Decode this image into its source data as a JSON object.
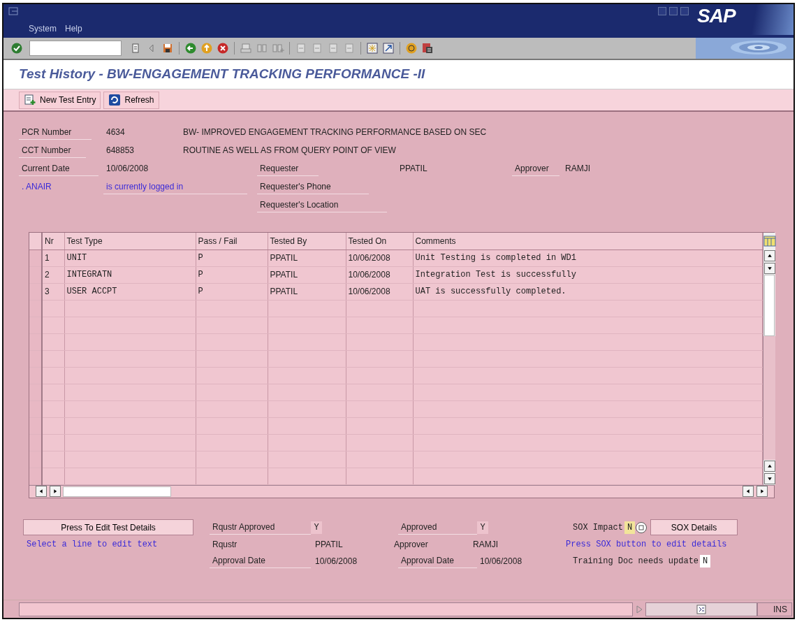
{
  "window": {
    "menu": [
      {
        "label": "System"
      },
      {
        "label": "Help"
      }
    ],
    "logo": "SAP"
  },
  "title": "Test History - BW-ENGAGEMENT TRACKING PERFORMANCE -II",
  "app_toolbar": [
    {
      "label": "New Test Entry",
      "kind": "new"
    },
    {
      "label": "Refresh",
      "kind": "refresh"
    }
  ],
  "header": {
    "pcr": {
      "label": "PCR Number",
      "value": "4634",
      "description": "BW- IMPROVED ENGAGEMENT TRACKING PERFORMANCE BASED ON SEC"
    },
    "cct": {
      "label": "CCT Number",
      "value": "648853",
      "description": "ROUTINE AS WELL AS FROM QUERY POINT OF VIEW"
    },
    "current_date": {
      "label": "Current Date",
      "value": "10/06/2008"
    },
    "user": {
      "name": ". ANAIR",
      "status": "is currently logged in"
    },
    "requester": {
      "label": "Requester",
      "value": "PPATIL"
    },
    "approver": {
      "label": "Approver",
      "value": "RAMJI"
    },
    "requester_phone": {
      "label": "Requester's Phone"
    },
    "requester_location": {
      "label": "Requester's Location"
    }
  },
  "table": {
    "columns": [
      "Nr",
      "Test Type",
      "Pass / Fail",
      "Tested By",
      "Tested On",
      "Comments"
    ],
    "rows": [
      {
        "nr": "1",
        "test_type": "UNIT",
        "pass_fail": "P",
        "tested_by": "PPATIL",
        "tested_on": "10/06/2008",
        "comments": "Unit Testing is completed in WD1"
      },
      {
        "nr": "2",
        "test_type": "INTEGRATN",
        "pass_fail": "P",
        "tested_by": "PPATIL",
        "tested_on": "10/06/2008",
        "comments": "Integration Test is successfully"
      },
      {
        "nr": "3",
        "test_type": "USER ACCPT",
        "pass_fail": "P",
        "tested_by": "PPATIL",
        "tested_on": "10/06/2008",
        "comments": "UAT is successfully completed."
      }
    ]
  },
  "bottom": {
    "edit_button": "Press To Edit Test Details",
    "hint": "Select a line to edit text",
    "rqustr_approved": {
      "label": "Rqustr Approved",
      "value": "Y"
    },
    "approved": {
      "label": "Approved",
      "value": "Y"
    },
    "rqustr": {
      "label": "Rqustr",
      "value": "PPATIL"
    },
    "approver": {
      "label": "Approver",
      "value": "RAMJI"
    },
    "rqustr_date": {
      "label": "Approval Date",
      "value": "10/06/2008"
    },
    "approver_date": {
      "label": "Approval Date",
      "value": "10/06/2008"
    },
    "sox_impact": {
      "label": "SOX Impact",
      "value": "N",
      "highlighted": true
    },
    "sox_button": "SOX Details",
    "sox_hint": "Press SOX button to edit details",
    "training": {
      "label": "Training Doc needs update",
      "value": "N",
      "highlighted": false
    }
  },
  "status_bar": {
    "mode": "INS"
  }
}
